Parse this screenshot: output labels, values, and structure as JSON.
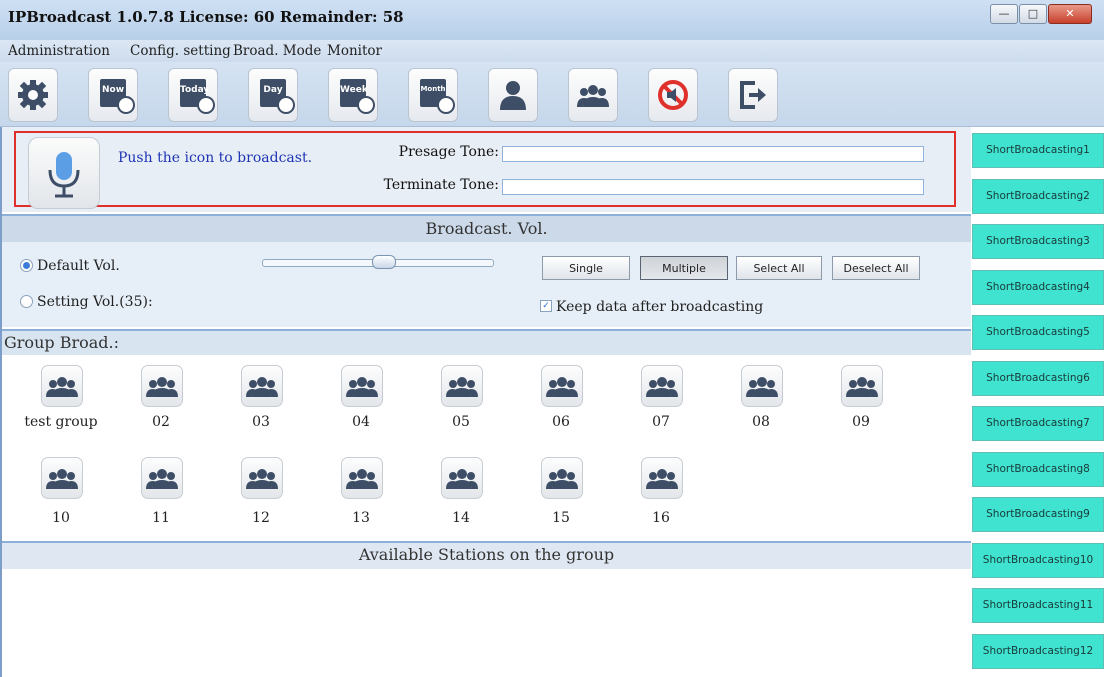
{
  "window": {
    "title": "IPBroadcast 1.0.7.8 License: 60 Remainder: 58"
  },
  "menu": [
    "Administration",
    "Config. setting",
    "Broad. Mode",
    "Monitor"
  ],
  "toolbar": {
    "calendar_labels": [
      "Now",
      "Today",
      "Day",
      "Week",
      "Month"
    ]
  },
  "mic_panel": {
    "push_text": "Push the icon to broadcast.",
    "presage_label": "Presage Tone:",
    "presage_value": "",
    "terminate_label": "Terminate Tone:",
    "terminate_value": ""
  },
  "volume": {
    "header": "Broadcast. Vol.",
    "default_label": "Default Vol.",
    "setting_label": "Setting Vol.(35):",
    "selected": "default",
    "slider_level": 0.5,
    "buttons": {
      "single": "Single",
      "multiple": "Multiple",
      "select_all": "Select All",
      "deselect_all": "Deselect All"
    },
    "active_mode": "Multiple",
    "keep_data_label": "Keep data after broadcasting",
    "keep_data_checked": true
  },
  "groups": {
    "header": "Group Broad.:",
    "items": [
      "test group",
      "02",
      "03",
      "04",
      "05",
      "06",
      "07",
      "08",
      "09",
      "10",
      "11",
      "12",
      "13",
      "14",
      "15",
      "16"
    ]
  },
  "available": {
    "header": "Available Stations on the group"
  },
  "short_broadcasts": [
    "ShortBroadcasting1",
    "ShortBroadcasting2",
    "ShortBroadcasting3",
    "ShortBroadcasting4",
    "ShortBroadcasting5",
    "ShortBroadcasting6",
    "ShortBroadcasting7",
    "ShortBroadcasting8",
    "ShortBroadcasting9",
    "ShortBroadcasting10",
    "ShortBroadcasting11",
    "ShortBroadcasting12"
  ],
  "colors": {
    "accent_red": "#e0302c",
    "short_btn": "#3fe3cf",
    "link_blue": "#1f35b5"
  }
}
